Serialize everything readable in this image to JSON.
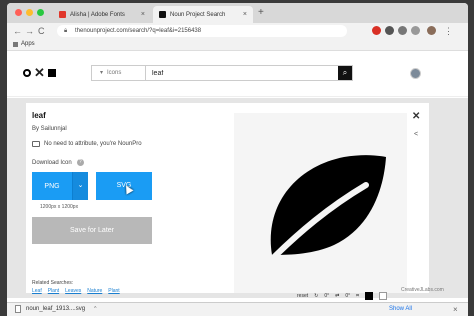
{
  "browser": {
    "tabs": [
      {
        "label": "Alisha | Adobe Fonts",
        "close": "×"
      },
      {
        "label": "Noun Project Search",
        "close": "×"
      }
    ],
    "new_tab": "+",
    "nav": {
      "back": "←",
      "forward": "→",
      "reload": "C"
    },
    "url": "thenounproject.com/search/?q=leaf&i=2156438",
    "bookmarks_label": "Apps",
    "colors": {
      "tab_bar": "#d8d8d8",
      "toolbar": "#f2f2f2"
    }
  },
  "site": {
    "search_type": "Icons",
    "search_value": "leaf",
    "search_icon": "search-icon",
    "accent": "#1a9cf4"
  },
  "icon_modal": {
    "title": "leaf",
    "byline": "By Sailunnjal",
    "attribution_note": "No need to attribute, you're NounPro",
    "download_label": "Download Icon",
    "help": "?",
    "png_label": "PNG",
    "svg_label": "SVG",
    "caret": "⌄",
    "size_note": "1200px x 1200px",
    "save_label": "Save for Later",
    "related_label": "Related Searches:",
    "related": [
      "Leaf",
      "Plant",
      "Leaves",
      "Nature",
      "Plant"
    ],
    "close": "✕",
    "share": "<",
    "edit_reset": "reset",
    "edit_rotate": "0°",
    "edit_flip": "0°",
    "watermark": "CreativeJLabs.com"
  },
  "download_shelf": {
    "file": "noun_leaf_1913....svg",
    "caret": "^",
    "show_all": "Show All",
    "close": "×"
  }
}
